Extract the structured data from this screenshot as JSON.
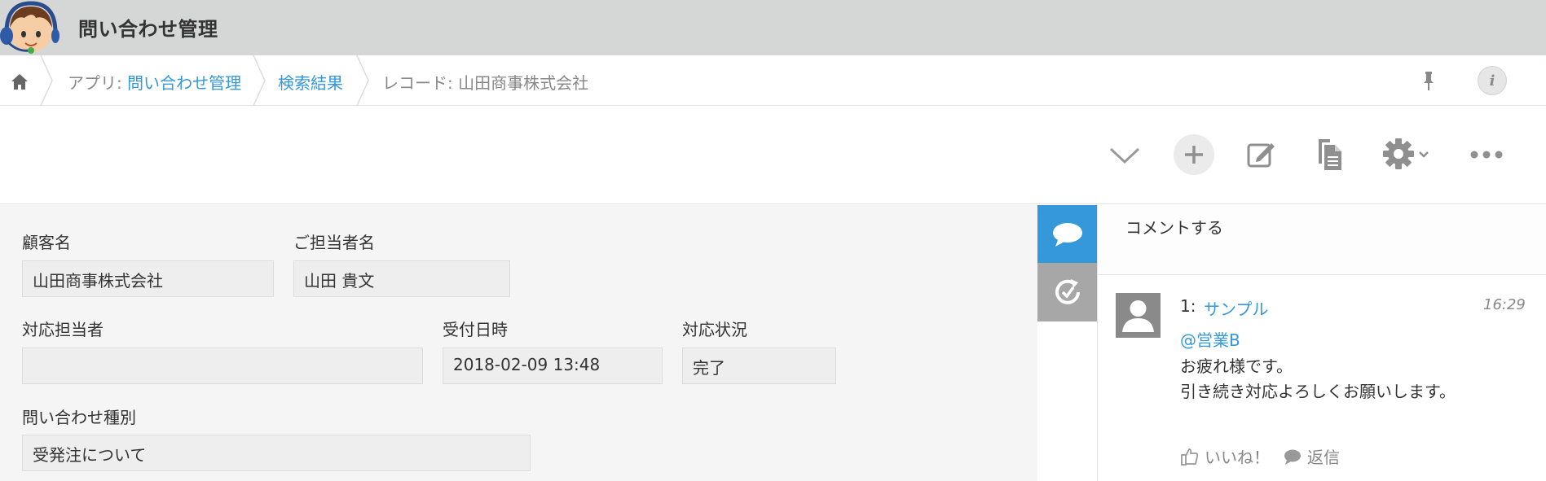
{
  "header": {
    "app_title": "問い合わせ管理"
  },
  "breadcrumb": {
    "app_prefix": "アプリ: ",
    "app_name": "問い合わせ管理",
    "search_results": "検索結果",
    "record_prefix": "レコード: ",
    "record_name": "山田商事株式会社"
  },
  "toolbar": {
    "icons": [
      "chevron-down-icon",
      "plus-icon",
      "edit-icon",
      "copy-icon",
      "gear-icon",
      "more-icon"
    ]
  },
  "record": {
    "fields": {
      "customer_name": {
        "label": "顧客名",
        "value": "山田商事株式会社"
      },
      "contact_person": {
        "label": "ご担当者名",
        "value": "山田 貴文"
      },
      "assignee": {
        "label": "対応担当者",
        "value": ""
      },
      "received_at": {
        "label": "受付日時",
        "value": "2018-02-09 13:48"
      },
      "status": {
        "label": "対応状況",
        "value": "完了"
      },
      "inquiry_type": {
        "label": "問い合わせ種別",
        "value": "受発注について"
      }
    }
  },
  "comments": {
    "input_placeholder": "コメントする",
    "items": [
      {
        "number": "1:",
        "user": "サンプル",
        "time": "16:29",
        "mention": "@営業B",
        "lines": [
          "お疲れ様です。",
          "引き続き対応よろしくお願いします。"
        ],
        "like_label": "いいね！",
        "reply_label": "返信"
      }
    ]
  },
  "colors": {
    "header_bg": "#d5d6d6",
    "accent": "#3498db",
    "tab_inactive": "#a7a7a7",
    "record_bg": "#f5f5f5"
  }
}
